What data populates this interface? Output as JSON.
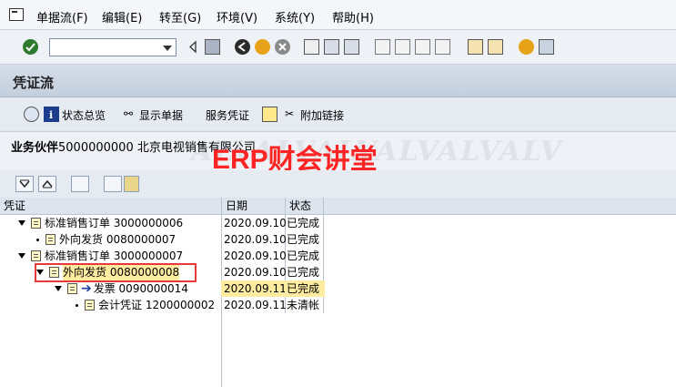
{
  "menubar": {
    "items": [
      "单据流(F)",
      "编辑(E)",
      "转至(G)",
      "环境(V)",
      "系统(Y)",
      "帮助(H)"
    ]
  },
  "toolbar": {
    "command_value": ""
  },
  "title": "凭证流",
  "app_toolbar": {
    "status_overview": "状态总览",
    "display_document": "显示单据",
    "service_document": "服务凭证",
    "additional_links": "附加链接"
  },
  "header": {
    "partner_label": "业务伙伴",
    "partner_value": "5000000000 北京电视销售有限公司",
    "background_text": "ALVALVALVALVALVALV"
  },
  "watermark": "ERP财会讲堂",
  "tree": {
    "columns": [
      "凭证",
      "日期",
      "状态"
    ],
    "rows": [
      {
        "label": "标准销售订单 3000000006",
        "date": "2020.09.10",
        "status": "已完成"
      },
      {
        "label": "外向发货 0080000007",
        "date": "2020.09.10",
        "status": "已完成"
      },
      {
        "label": "标准销售订单 3000000007",
        "date": "2020.09.10",
        "status": "已完成"
      },
      {
        "label": "外向发货 0080000008",
        "date": "2020.09.10",
        "status": "已完成"
      },
      {
        "label": "发票 0090000014",
        "date": "2020.09.11",
        "status": "已完成"
      },
      {
        "label": "会计凭证 1200000002",
        "date": "2020.09.11",
        "status": "未清帐"
      }
    ]
  },
  "colors": {
    "highlight_red": "#e22828",
    "selection_yellow": "#ffeca0"
  }
}
